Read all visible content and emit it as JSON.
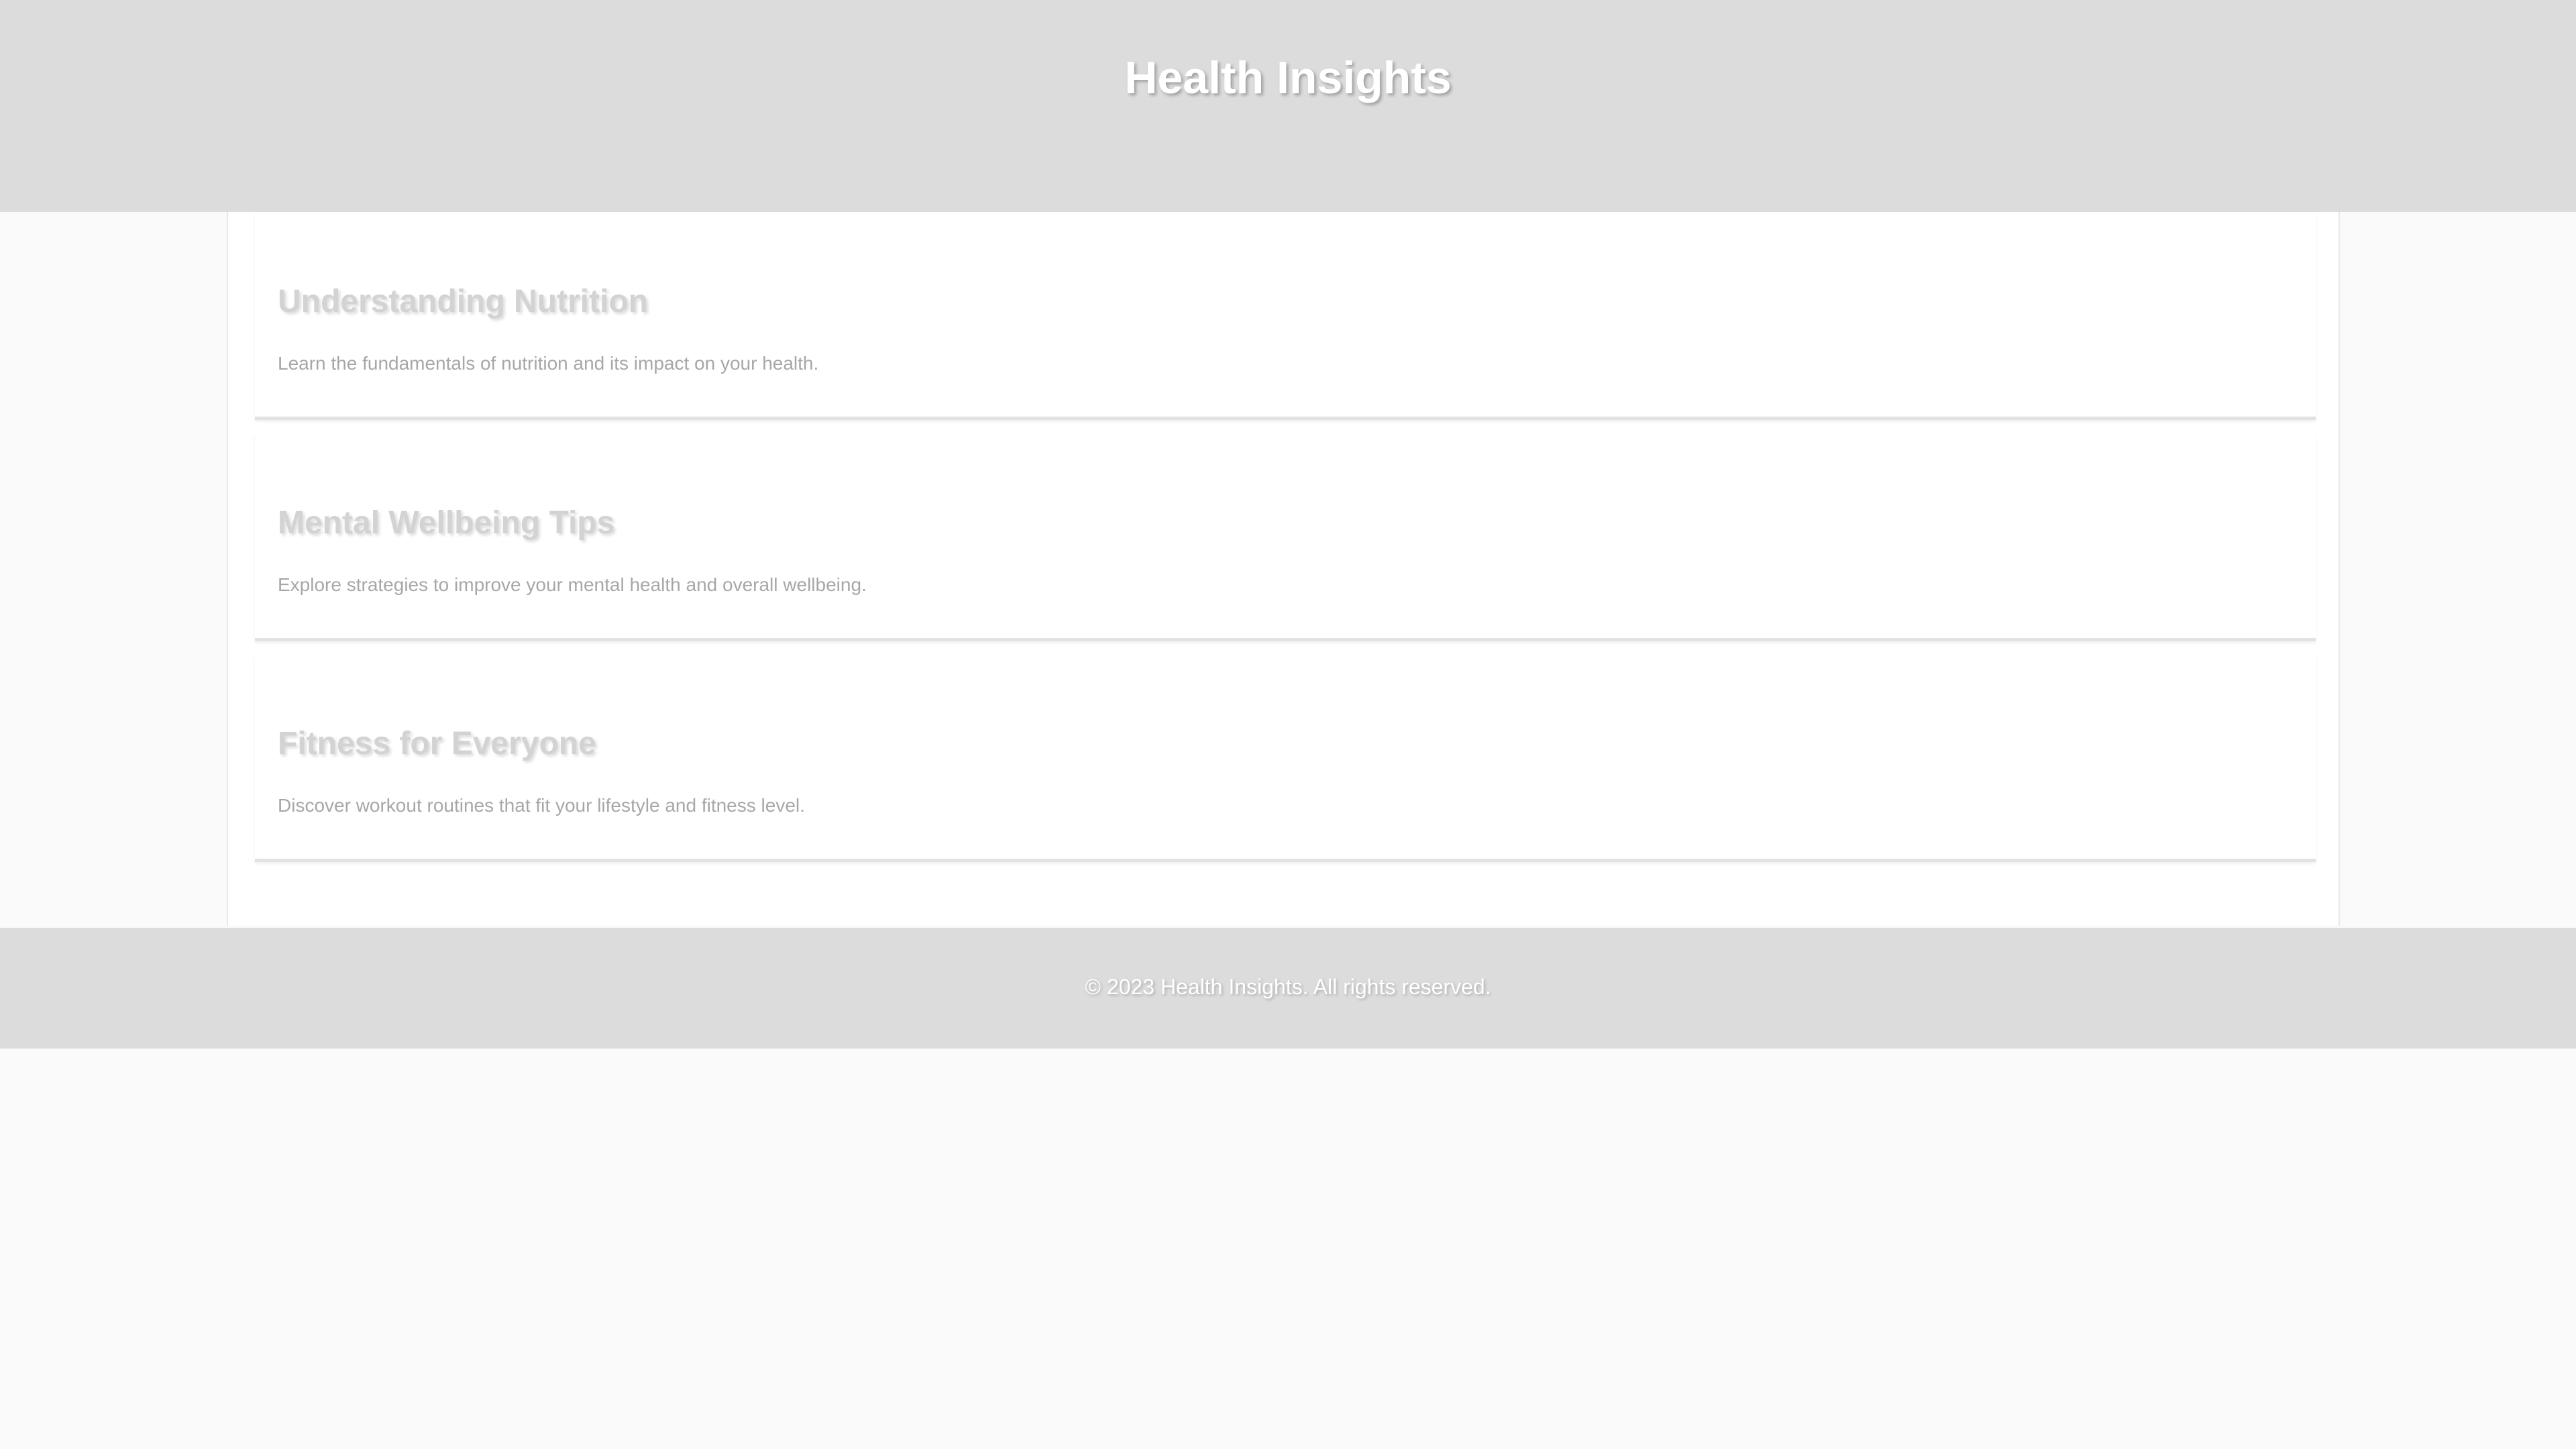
{
  "header": {
    "title": "Health Insights"
  },
  "articles": [
    {
      "title": "Understanding Nutrition",
      "description": "Learn the fundamentals of nutrition and its impact on your health."
    },
    {
      "title": "Mental Wellbeing Tips",
      "description": "Explore strategies to improve your mental health and overall wellbeing."
    },
    {
      "title": "Fitness for Everyone",
      "description": "Discover workout routines that fit your lifestyle and fitness level."
    }
  ],
  "footer": {
    "text": "© 2023 Health Insights. All rights reserved."
  },
  "colors": {
    "header_background": "#dcdcdc",
    "page_background": "#fafafa",
    "content_background": "#ffffff",
    "title_text": "#ffffff",
    "article_title": "#d3d3d3",
    "article_text": "#a7a7a7"
  }
}
